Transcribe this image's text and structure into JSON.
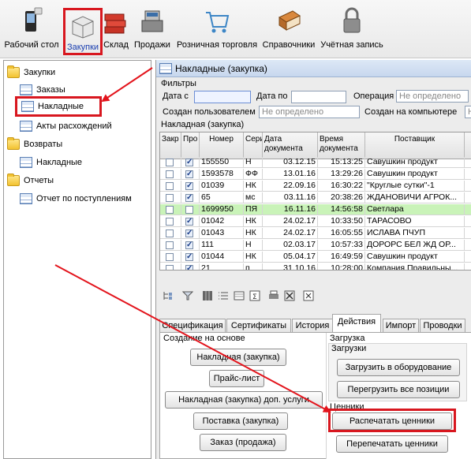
{
  "toolbar": {
    "items": [
      {
        "label": "Рабочий стол",
        "icon": "phone-icon"
      },
      {
        "label": "Закупки",
        "icon": "boxes-icon"
      },
      {
        "label": "Склад",
        "icon": "stack-icon"
      },
      {
        "label": "Продажи",
        "icon": "cash-register-icon"
      },
      {
        "label": "Розничная торговля",
        "icon": "cart-icon"
      },
      {
        "label": "Справочники",
        "icon": "book-icon"
      },
      {
        "label": "Учётная запись",
        "icon": "lock-icon"
      }
    ]
  },
  "tree": {
    "groups": [
      {
        "label": "Закупки",
        "items": [
          "Заказы",
          "Накладные",
          "Акты расхождений"
        ]
      },
      {
        "label": "Возвраты",
        "items": [
          "Накладные"
        ]
      },
      {
        "label": "Отчеты",
        "items": [
          "Отчет по поступлениям"
        ]
      }
    ]
  },
  "window": {
    "title": "Накладные (закупка)",
    "filters": {
      "section": "Фильтры",
      "date_from_label": "Дата с",
      "date_to_label": "Дата по",
      "operation_label": "Операция",
      "operation_value": "Не определено",
      "created_user_label": "Создан пользователем",
      "created_user_value": "Не определено",
      "created_pc_label": "Создан на компьютере",
      "created_pc_value": "Не определе"
    },
    "grid_title": "Накладная (закупка)",
    "columns": [
      "Закр",
      "Про",
      "Номер",
      "Сери",
      "Дата\nдокумента",
      "Время\nдокумента",
      "Поставщик"
    ],
    "rows": [
      {
        "closed": false,
        "posted": true,
        "number": "155550",
        "series": "Н",
        "date": "03.12.15",
        "time": "15:13:25",
        "supplier": "Савушкин продукт"
      },
      {
        "closed": false,
        "posted": true,
        "number": "1593578",
        "series": "ФФ",
        "date": "13.01.16",
        "time": "13:29:26",
        "supplier": "Савушкин продукт"
      },
      {
        "closed": false,
        "posted": true,
        "number": "01039",
        "series": "НК",
        "date": "22.09.16",
        "time": "16:30:22",
        "supplier": "\"Круглые сутки\"-1"
      },
      {
        "closed": false,
        "posted": true,
        "number": "65",
        "series": "мс",
        "date": "03.11.16",
        "time": "20:38:26",
        "supplier": "ЖДАНОВИЧИ АГРОК..."
      },
      {
        "closed": false,
        "posted": false,
        "number": "1699950",
        "series": "ПЯ",
        "date": "16.11.16",
        "time": "14:56:58",
        "supplier": "Светлара"
      },
      {
        "closed": false,
        "posted": true,
        "number": "01042",
        "series": "НК",
        "date": "24.02.17",
        "time": "10:33:50",
        "supplier": "ТАРАСОВО"
      },
      {
        "closed": false,
        "posted": true,
        "number": "01043",
        "series": "НК",
        "date": "24.02.17",
        "time": "16:05:55",
        "supplier": "ИСЛАВА ПЧУП"
      },
      {
        "closed": false,
        "posted": true,
        "number": "111",
        "series": "Н",
        "date": "02.03.17",
        "time": "10:57:33",
        "supplier": "ДОРОРС БЕЛ ЖД  ОР..."
      },
      {
        "closed": false,
        "posted": true,
        "number": "01044",
        "series": "НК",
        "date": "05.04.17",
        "time": "16:49:59",
        "supplier": "Савушкин продукт"
      },
      {
        "closed": false,
        "posted": true,
        "number": "21",
        "series": "п",
        "date": "31.10.16",
        "time": "10:28:00",
        "supplier": "Компания Правильны..."
      }
    ],
    "tabs": [
      "Спецификация",
      "Сертификаты",
      "История",
      "Действия",
      "Импорт",
      "Проводки"
    ],
    "active_tab": "Действия",
    "create_section": "Создание на основе",
    "create_buttons": [
      "Накладная (закупка)",
      "Прайс-лист",
      "Накладная (закупка) доп. услуги",
      "Поставка (закупка)",
      "Заказ (продажа)"
    ],
    "load_section": "Загрузка",
    "load_subsection": "Загрузки",
    "load_buttons": [
      "Загрузить в оборудование",
      "Перегрузить все позиции"
    ],
    "price_tags_section": "Ценники",
    "price_tag_buttons": [
      "Распечатать ценники",
      "Перепечатать ценники"
    ]
  },
  "colors": {
    "highlight": "#d8171f",
    "row_green": "#c9f3b8"
  }
}
